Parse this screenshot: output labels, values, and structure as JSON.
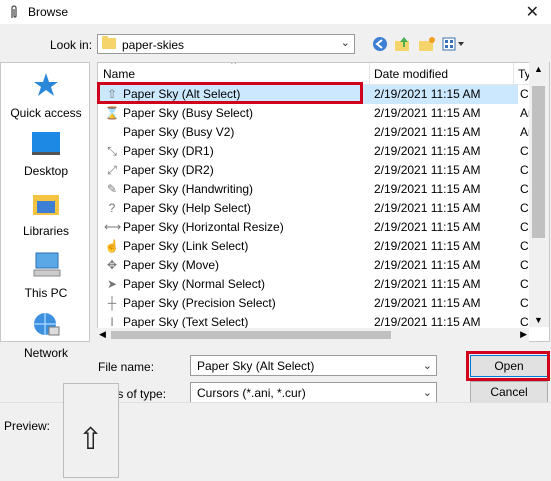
{
  "window": {
    "title": "Browse",
    "close": "✕"
  },
  "lookin": {
    "label": "Look in:",
    "value": "paper-skies",
    "arrow": "⌄"
  },
  "toolbar": {
    "back": "back-icon",
    "up": "up-folder-icon",
    "newfolder": "new-folder-icon",
    "view": "view-menu-icon"
  },
  "places": [
    {
      "label": "Quick access",
      "icon": "star-icon"
    },
    {
      "label": "Desktop",
      "icon": "desktop-icon"
    },
    {
      "label": "Libraries",
      "icon": "libraries-icon"
    },
    {
      "label": "This PC",
      "icon": "pc-icon"
    },
    {
      "label": "Network",
      "icon": "network-icon"
    }
  ],
  "columns": {
    "name": "Name",
    "date": "Date modified",
    "type": "Ty"
  },
  "files": [
    {
      "name": "Paper Sky (Alt Select)",
      "date": "2/19/2021 11:15 AM",
      "type": "Cu",
      "icon": "⇧"
    },
    {
      "name": "Paper Sky (Busy Select)",
      "date": "2/19/2021 11:15 AM",
      "type": "An",
      "icon": "⌛"
    },
    {
      "name": "Paper Sky (Busy V2)",
      "date": "2/19/2021 11:15 AM",
      "type": "An",
      "icon": ""
    },
    {
      "name": "Paper Sky (DR1)",
      "date": "2/19/2021 11:15 AM",
      "type": "Cu",
      "icon": "⤡"
    },
    {
      "name": "Paper Sky (DR2)",
      "date": "2/19/2021 11:15 AM",
      "type": "Cu",
      "icon": "⤢"
    },
    {
      "name": "Paper Sky (Handwriting)",
      "date": "2/19/2021 11:15 AM",
      "type": "Cu",
      "icon": "✎"
    },
    {
      "name": "Paper Sky (Help Select)",
      "date": "2/19/2021 11:15 AM",
      "type": "Cu",
      "icon": "?"
    },
    {
      "name": "Paper Sky (Horizontal Resize)",
      "date": "2/19/2021 11:15 AM",
      "type": "Cu",
      "icon": "⟷"
    },
    {
      "name": "Paper Sky (Link Select)",
      "date": "2/19/2021 11:15 AM",
      "type": "Cu",
      "icon": "☝"
    },
    {
      "name": "Paper Sky (Move)",
      "date": "2/19/2021 11:15 AM",
      "type": "Cu",
      "icon": "✥"
    },
    {
      "name": "Paper Sky (Normal Select)",
      "date": "2/19/2021 11:15 AM",
      "type": "Cu",
      "icon": "➤"
    },
    {
      "name": "Paper Sky (Precision Select)",
      "date": "2/19/2021 11:15 AM",
      "type": "Cu",
      "icon": "┼"
    },
    {
      "name": "Paper Sky (Text Select)",
      "date": "2/19/2021 11:15 AM",
      "type": "Cu",
      "icon": "I"
    }
  ],
  "filename": {
    "label": "File name:",
    "value": "Paper Sky (Alt Select)"
  },
  "filetype": {
    "label": "Files of type:",
    "value": "Cursors (*.ani, *.cur)"
  },
  "buttons": {
    "open": "Open",
    "cancel": "Cancel"
  },
  "preview": {
    "label": "Preview:",
    "glyph": "⇧"
  },
  "colors": {
    "highlight": "#d0021b",
    "selection": "#cce8ff",
    "accent": "#0078d7"
  }
}
